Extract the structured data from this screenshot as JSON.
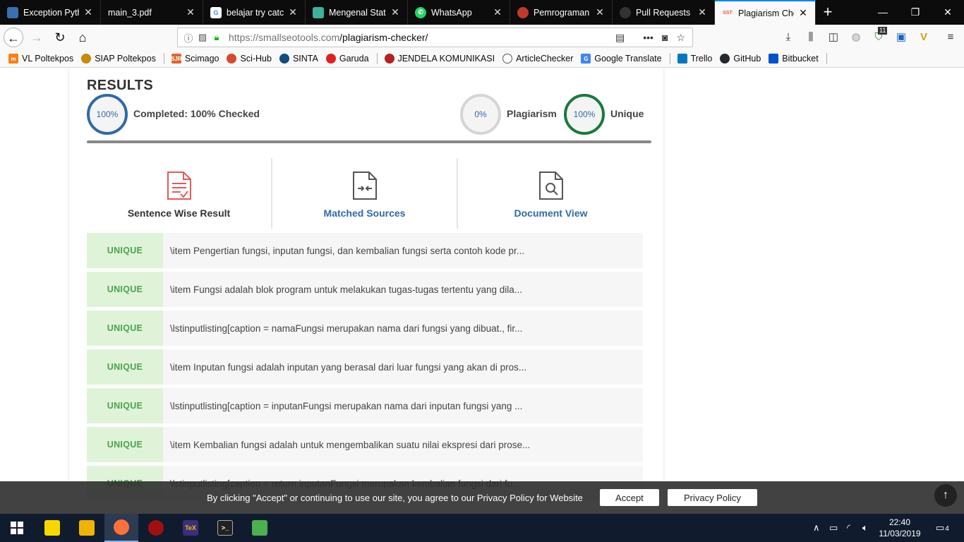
{
  "browser": {
    "tabs": [
      {
        "title": "Exception Pytho",
        "icon": "python-icon",
        "color": "#3a6fb0"
      },
      {
        "title": "main_3.pdf",
        "icon": "pdf-icon",
        "color": ""
      },
      {
        "title": "belajar try catch",
        "icon": "google-icon",
        "color": "#4285f4"
      },
      {
        "title": "Mengenal State",
        "icon": "app-icon",
        "color": "#3db39e"
      },
      {
        "title": "WhatsApp",
        "icon": "whatsapp-icon",
        "color": "#25d366"
      },
      {
        "title": "Pemrograman P",
        "icon": "app-icon",
        "color": "#c0392b"
      },
      {
        "title": "Pull Requests - p",
        "icon": "github-icon",
        "color": "#333333"
      },
      {
        "title": "Plagiarism Chec",
        "icon": "sst-icon",
        "color": "#e45b2c"
      }
    ],
    "url_host": "https://smallseotools.com",
    "url_path": "/plagiarism-checker/",
    "extension_badge": "11",
    "bookmarks": [
      {
        "label": "VL Poltekpos",
        "icon": "moodle-icon",
        "color": "#f98012"
      },
      {
        "label": "SIAP Poltekpos",
        "icon": "siap-icon",
        "color": "#cc8800"
      },
      {
        "label": "Scimago",
        "icon": "sjr-icon",
        "color": "#e0662c"
      },
      {
        "label": "Sci-Hub",
        "icon": "scihub-icon",
        "color": "#d64b2a"
      },
      {
        "label": "SINTA",
        "icon": "sinta-icon",
        "color": "#0f4c81"
      },
      {
        "label": "Garuda",
        "icon": "garuda-icon",
        "color": "#e02020"
      },
      {
        "label": "JENDELA KOMUNIKASI",
        "icon": "jendela-icon",
        "color": "#b22222"
      },
      {
        "label": "ArticleChecker",
        "icon": "globe-icon",
        "color": "#555555"
      },
      {
        "label": "Google Translate",
        "icon": "translate-icon",
        "color": "#4285f4"
      },
      {
        "label": "Trello",
        "icon": "trello-icon",
        "color": "#0079bf"
      },
      {
        "label": "GitHub",
        "icon": "github-icon",
        "color": "#24292e"
      },
      {
        "label": "Bitbucket",
        "icon": "bitbucket-icon",
        "color": "#0052cc"
      }
    ]
  },
  "results": {
    "title": "RESULTS",
    "completed_percent": "100%",
    "completed_label": "Completed: 100% Checked",
    "plagiarism_percent": "0%",
    "plagiarism_label": "Plagiarism",
    "unique_percent": "100%",
    "unique_label": "Unique",
    "tabs": [
      {
        "label": "Sentence Wise Result",
        "icon": "sentence-document-icon"
      },
      {
        "label": "Matched Sources",
        "icon": "matched-sources-icon"
      },
      {
        "label": "Document View",
        "icon": "document-search-icon"
      }
    ],
    "rows": [
      {
        "status": "UNIQUE",
        "text": "\\item Pengertian fungsi, inputan fungsi, dan kembalian fungsi serta contoh kode pr..."
      },
      {
        "status": "UNIQUE",
        "text": "\\item Fungsi adalah blok program untuk melakukan tugas-tugas tertentu yang dila..."
      },
      {
        "status": "UNIQUE",
        "text": "\\lstinputlisting[caption = namaFungsi merupakan nama dari fungsi yang dibuat., fir..."
      },
      {
        "status": "UNIQUE",
        "text": "\\item Inputan fungsi adalah inputan yang berasal dari luar fungsi yang akan di pros..."
      },
      {
        "status": "UNIQUE",
        "text": "\\lstinputlisting[caption = inputanFungsi merupakan nama dari inputan fungsi yang ..."
      },
      {
        "status": "UNIQUE",
        "text": "\\item Kembalian fungsi adalah untuk mengembalikan suatu nilai ekspresi dari prose..."
      },
      {
        "status": "UNIQUE",
        "text": "\\lstinputlisting[caption = return inputanFungsi merupakan kembalian fungsi dari fu..."
      }
    ],
    "colors": {
      "completed_ring": "#2f6aa8",
      "plagiarism_ring": "#d5d5d5",
      "unique_ring": "#1a7a3e",
      "active_tab_text": "#333333",
      "link_tab_text": "#2f6aa8",
      "unique_badge_bg": "#dff3d8",
      "unique_badge_text": "#4ca24c"
    }
  },
  "cookie_banner": {
    "text": "By clicking \"Accept\" or continuing to use our site, you agree to our Privacy Policy for Website",
    "accept_label": "Accept",
    "privacy_label": "Privacy Policy"
  },
  "taskbar": {
    "apps": [
      {
        "name": "sticky-notes-icon",
        "color": "#f5d800"
      },
      {
        "name": "file-explorer-icon",
        "color": "#f0b400"
      },
      {
        "name": "firefox-icon",
        "color": "#ff7139"
      },
      {
        "name": "spyder-icon",
        "color": "#a01010"
      },
      {
        "name": "texmaker-icon",
        "color": "#3a2f7a"
      },
      {
        "name": "terminal-icon",
        "color": "#222222"
      },
      {
        "name": "editor-icon",
        "color": "#4caf50"
      }
    ],
    "time": "22:40",
    "date": "11/03/2019",
    "notification_count": "4"
  }
}
